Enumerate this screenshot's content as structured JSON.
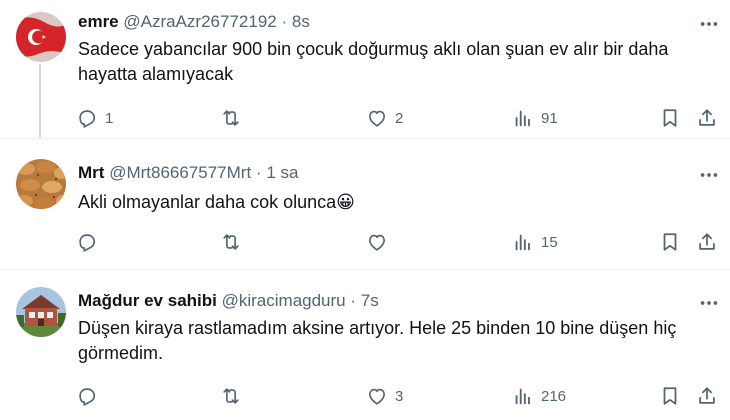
{
  "tweets": [
    {
      "name": "emre",
      "handle": "@AzraAzr26772192",
      "dot": "·",
      "time": "8s",
      "text": "Sadece yabancılar 900 bin çocuk doğurmuş aklı olan şuan ev alır bir daha hayatta alamıyacak",
      "replies": "1",
      "reposts": "",
      "likes": "2",
      "views": "91"
    },
    {
      "name": "Mrt",
      "handle": "@Mrt86667577Mrt",
      "dot": "·",
      "time": "1 sa",
      "text": "Akli olmayanlar daha cok olunca",
      "emoji": "😀",
      "replies": "",
      "reposts": "",
      "likes": "",
      "views": "15"
    },
    {
      "name": "Mağdur ev sahibi",
      "handle": "@kiracimagduru",
      "dot": "·",
      "time": "7s",
      "text": "Düşen kiraya rastlamadım aksine artıyor. Hele 25 binden 10 bine düşen hiç görmedim.",
      "replies": "",
      "reposts": "",
      "likes": "3",
      "views": "216"
    }
  ],
  "colors": {
    "text": "#0f1419",
    "secondary": "#536471",
    "divider": "#eff3f4",
    "thread_line": "#cfd9de"
  },
  "icons": [
    "more-icon",
    "reply-icon",
    "repost-icon",
    "like-icon",
    "views-icon",
    "bookmark-icon",
    "share-icon"
  ]
}
